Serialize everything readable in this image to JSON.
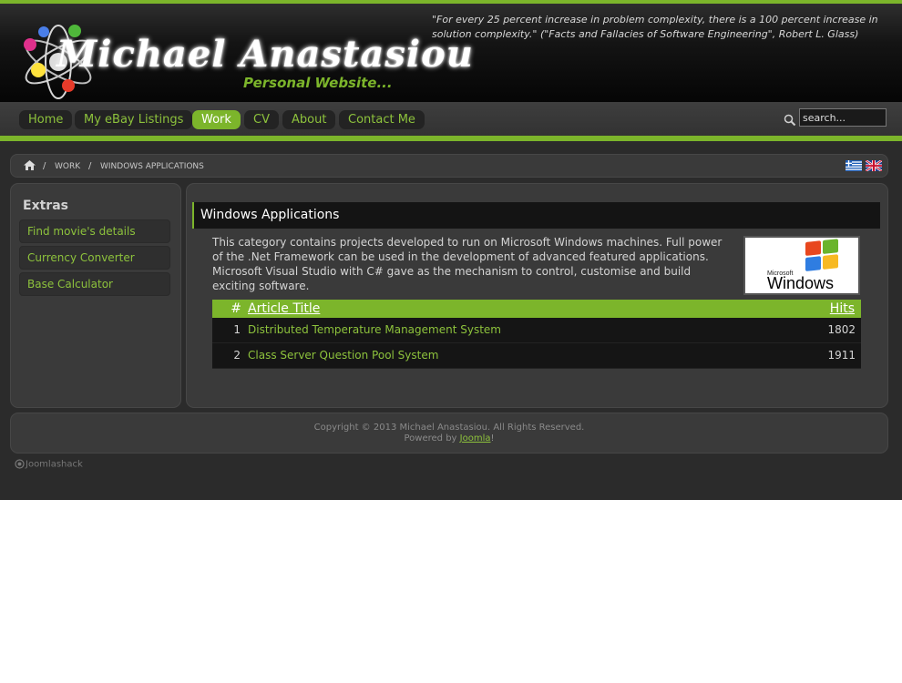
{
  "header": {
    "site_name": "Michael Anastasiou",
    "tagline": "Personal Website...",
    "quote": "\"For every 25 percent increase in problem complexity, there is a 100 percent increase in solution complexity.\" (\"Facts and Fallacies of Software Engineering\", Robert L. Glass)"
  },
  "nav": {
    "items": [
      {
        "label": "Home"
      },
      {
        "label": "My eBay Listings"
      },
      {
        "label": "Work"
      },
      {
        "label": "CV"
      },
      {
        "label": "About"
      },
      {
        "label": "Contact Me"
      }
    ],
    "active_index": 2,
    "search_value": "search..."
  },
  "breadcrumb": {
    "items": [
      "Work",
      "Windows Applications"
    ]
  },
  "languages": [
    "greek-flag-icon",
    "uk-flag-icon"
  ],
  "sidebar": {
    "title": "Extras",
    "links": [
      {
        "label": "Find movie's details"
      },
      {
        "label": "Currency Converter"
      },
      {
        "label": "Base Calculator"
      }
    ]
  },
  "content": {
    "title": "Windows Applications",
    "description": "This category contains projects developed to run on Microsoft Windows machines. Full power of the .Net Framework can be used in the development of advanced featured applications. Microsoft Visual Studio with C# gave as the mechanism to control, customise and build exciting software.",
    "image_text": {
      "brand": "Microsoft",
      "product": "Windows"
    },
    "table": {
      "headers": {
        "num": "#",
        "title": "Article Title",
        "hits": "Hits"
      },
      "rows": [
        {
          "num": "1",
          "title": "Distributed Temperature Management System",
          "hits": "1802"
        },
        {
          "num": "2",
          "title": "Class Server Question Pool System",
          "hits": "1911"
        }
      ]
    }
  },
  "footer": {
    "copyright": "Copyright © 2013 Michael Anastasiou. All Rights Reserved.",
    "powered_prefix": "Powered by ",
    "powered_link": "Joomla",
    "powered_suffix": "!"
  },
  "credit": "Joomlashack",
  "colors": {
    "accent": "#7cb52b",
    "background": "#2b2b2b",
    "panel": "#3a3a3a"
  }
}
